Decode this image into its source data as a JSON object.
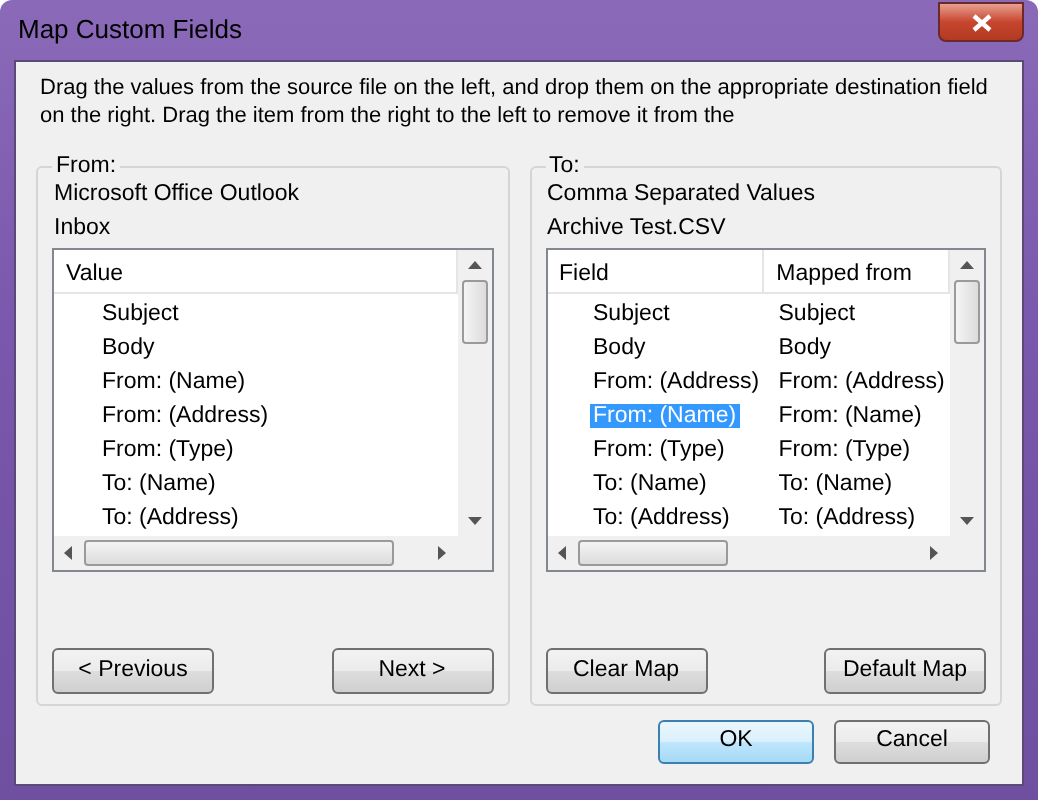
{
  "window": {
    "title": "Map Custom Fields"
  },
  "instructions": "Drag the values from the source file on the left, and drop them on the appropriate destination field on the right.  Drag the item from the right to the left to remove it from the",
  "source": {
    "legend": "From:",
    "lines": [
      "Microsoft Office Outlook",
      "Inbox"
    ],
    "columns": [
      "Value"
    ],
    "rows": [
      {
        "cells": [
          "Subject"
        ],
        "selected": false
      },
      {
        "cells": [
          "Body"
        ],
        "selected": false
      },
      {
        "cells": [
          "From: (Name)"
        ],
        "selected": false
      },
      {
        "cells": [
          "From: (Address)"
        ],
        "selected": false
      },
      {
        "cells": [
          "From: (Type)"
        ],
        "selected": false
      },
      {
        "cells": [
          "To: (Name)"
        ],
        "selected": false
      },
      {
        "cells": [
          "To: (Address)"
        ],
        "selected": false
      }
    ],
    "buttons": [
      {
        "label": "< Previous"
      },
      {
        "label": "Next >"
      }
    ]
  },
  "destination": {
    "legend": "To:",
    "lines": [
      "Comma Separated Values",
      "Archive Test.CSV"
    ],
    "columns": [
      "Field",
      "Mapped from"
    ],
    "rows": [
      {
        "cells": [
          "Subject",
          "Subject"
        ],
        "selected": false
      },
      {
        "cells": [
          "Body",
          "Body"
        ],
        "selected": false
      },
      {
        "cells": [
          "From: (Address)",
          "From: (Address)"
        ],
        "selected": false
      },
      {
        "cells": [
          "From: (Name)",
          "From: (Name)"
        ],
        "selected": true
      },
      {
        "cells": [
          "From: (Type)",
          "From: (Type)"
        ],
        "selected": false
      },
      {
        "cells": [
          "To: (Name)",
          "To: (Name)"
        ],
        "selected": false
      },
      {
        "cells": [
          "To: (Address)",
          "To: (Address)"
        ],
        "selected": false
      }
    ],
    "buttons": [
      {
        "label": "Clear Map"
      },
      {
        "label": "Default Map"
      }
    ]
  },
  "dialog_buttons": [
    {
      "label": "OK",
      "default": true
    },
    {
      "label": "Cancel",
      "default": false
    }
  ]
}
